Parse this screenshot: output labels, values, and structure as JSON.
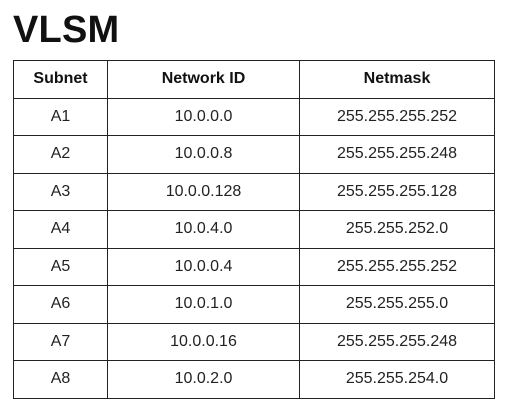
{
  "document": {
    "title": "VLSM"
  },
  "table": {
    "headers": {
      "subnet": "Subnet",
      "network_id": "Network ID",
      "netmask": "Netmask"
    },
    "rows": [
      {
        "subnet": "A1",
        "network_id": "10.0.0.0",
        "netmask": "255.255.255.252"
      },
      {
        "subnet": "A2",
        "network_id": "10.0.0.8",
        "netmask": "255.255.255.248"
      },
      {
        "subnet": "A3",
        "network_id": "10.0.0.128",
        "netmask": "255.255.255.128"
      },
      {
        "subnet": "A4",
        "network_id": "10.0.4.0",
        "netmask": "255.255.252.0"
      },
      {
        "subnet": "A5",
        "network_id": "10.0.0.4",
        "netmask": "255.255.255.252"
      },
      {
        "subnet": "A6",
        "network_id": "10.0.1.0",
        "netmask": "255.255.255.0"
      },
      {
        "subnet": "A7",
        "network_id": "10.0.0.16",
        "netmask": "255.255.255.248"
      },
      {
        "subnet": "A8",
        "network_id": "10.0.2.0",
        "netmask": "255.255.254.0"
      }
    ]
  }
}
